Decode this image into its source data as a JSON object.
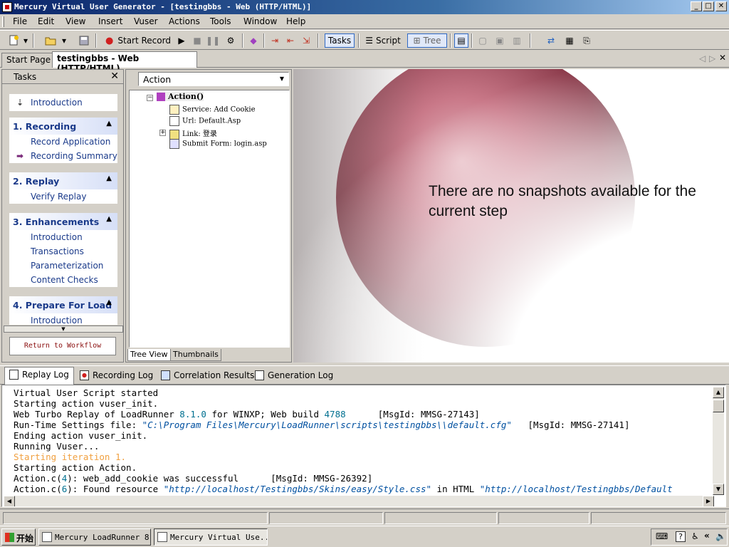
{
  "window": {
    "title": "Mercury Virtual User Generator - [testingbbs - Web (HTTP/HTML)]"
  },
  "menu": [
    "File",
    "Edit",
    "View",
    "Insert",
    "Vuser",
    "Actions",
    "Tools",
    "Window",
    "Help"
  ],
  "toolbar": {
    "start_record": "Start Record",
    "tasks": "Tasks",
    "script": "Script",
    "tree": "Tree"
  },
  "doc_tabs": [
    "Start Page",
    "testingbbs - Web (HTTP/HTML)"
  ],
  "tasks": {
    "header": "Tasks",
    "intro": "Introduction",
    "groups": [
      {
        "title": "1. Recording",
        "items": [
          "Record Application",
          "Recording Summary"
        ]
      },
      {
        "title": "2. Replay",
        "items": [
          "Verify Replay"
        ]
      },
      {
        "title": "3. Enhancements",
        "items": [
          "Introduction",
          "Transactions",
          "Parameterization",
          "Content Checks"
        ]
      },
      {
        "title": "4. Prepare For Load",
        "items": [
          "Introduction"
        ]
      }
    ],
    "return_button": "Return to Workflow"
  },
  "tree": {
    "selector": "Action",
    "root": "Action()",
    "nodes": [
      "Service: Add Cookie",
      "Url: Default.Asp",
      "Link: 登录",
      "Submit Form: login.asp"
    ],
    "tabs": [
      "Tree View",
      "Thumbnails"
    ]
  },
  "snapshot": {
    "message": "There are no snapshots available for the current step"
  },
  "log_tabs": [
    "Replay Log",
    "Recording Log",
    "Correlation Results",
    "Generation Log"
  ],
  "log_lines": [
    "Virtual User Script started",
    "Starting action vuser_init.",
    "Web Turbo Replay of LoadRunner 8.1.0 for WINXP; Web build 4788      [MsgId: MMSG-27143]",
    "Run-Time Settings file: \"C:\\Program Files\\Mercury\\LoadRunner\\scripts\\testingbbs\\\\default.cfg\"   [MsgId: MMSG-27141]",
    "Ending action vuser_init.",
    "Running Vuser...",
    "Starting iteration 1.",
    "Starting action Action.",
    "Action.c(4): web_add_cookie was successful      [MsgId: MMSG-26392]",
    "Action.c(6): Found resource \"http://localhost/Testingbbs/Skins/easy/Style.css\" in HTML \"http://localhost/Testingbbs/Default"
  ],
  "taskbar": {
    "start": "开始",
    "tasks": [
      "Mercury LoadRunner 8.1",
      "Mercury Virtual Use..."
    ]
  },
  "colors": {
    "title_bar": "#0a246a",
    "link_blue": "#1a3a8a",
    "log_number": "#007090",
    "log_string": "#0050a0",
    "log_iteration": "#f0a040"
  }
}
